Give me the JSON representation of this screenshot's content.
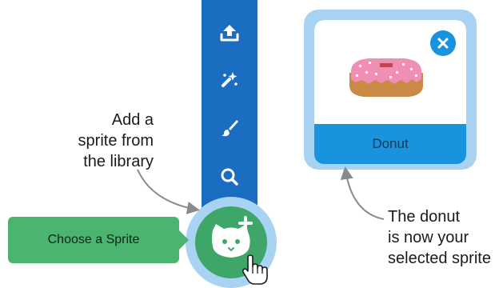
{
  "callouts": {
    "add_sprite": [
      "Add a",
      "sprite from",
      "the library"
    ],
    "donut_selected": [
      "The donut",
      "is now your",
      "selected sprite"
    ]
  },
  "toolbar": {
    "buttons": [
      {
        "name": "upload-icon"
      },
      {
        "name": "surprise-icon"
      },
      {
        "name": "paint-icon"
      },
      {
        "name": "search-icon"
      }
    ],
    "choose_sprite_icon": "cat-plus-icon"
  },
  "tooltip": {
    "label": "Choose a Sprite"
  },
  "sprite_card": {
    "name": "Donut",
    "close_icon": "close-icon"
  },
  "colors": {
    "toolbar_blue": "#1a6dc0",
    "choose_green": "#3fa66a",
    "tooltip_green": "#4cb471",
    "card_blue": "#1a93df",
    "halo": "#a9d3f2"
  }
}
